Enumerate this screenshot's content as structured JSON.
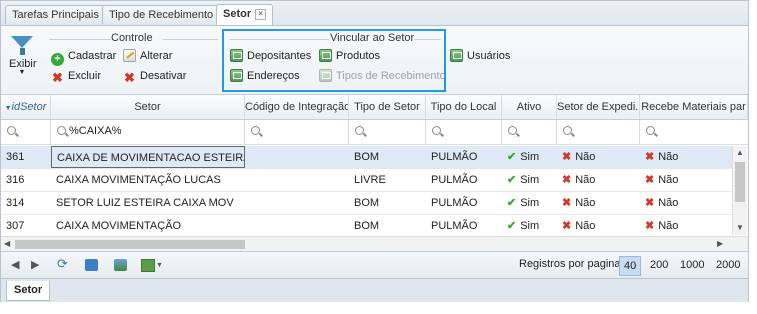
{
  "tabs": [
    {
      "label": "Tarefas Principais",
      "closable": false
    },
    {
      "label": "Tipo de Recebimento",
      "closable": true
    },
    {
      "label": "Setor",
      "closable": true,
      "active": true
    }
  ],
  "ribbon": {
    "exibir_label": "Exibir",
    "controle": {
      "title": "Controle",
      "cadastrar": "Cadastrar",
      "alterar": "Alterar",
      "excluir": "Excluir",
      "desativar": "Desativar"
    },
    "vincular": {
      "title": "Vincular ao Setor",
      "depositantes": "Depositantes",
      "produtos": "Produtos",
      "enderecos": "Endereços",
      "tipos_recebimento": "Tipos de Recebimento",
      "usuarios": "Usuários"
    }
  },
  "grid": {
    "columns": [
      "idSetor",
      "Setor",
      "Código de Integração",
      "Tipo de Setor",
      "Tipo do Local",
      "Ativo",
      "Setor de Expedi...",
      "Recebe Materiais par"
    ],
    "filter_value": "%CAIXA%",
    "rows": [
      {
        "id": "361",
        "setor": "CAIXA DE MOVIMENTACAO ESTEIRA",
        "codigo": "",
        "tipo_setor": "BOM",
        "tipo_local": "PULMÃO",
        "ativo": "Sim",
        "expedicao": "Não",
        "recebe": "Não"
      },
      {
        "id": "316",
        "setor": "CAIXA MOVIMENTAÇÃO LUCAS",
        "codigo": "",
        "tipo_setor": "LIVRE",
        "tipo_local": "PULMÃO",
        "ativo": "Sim",
        "expedicao": "Não",
        "recebe": "Não"
      },
      {
        "id": "314",
        "setor": "SETOR LUIZ ESTEIRA CAIXA MOV",
        "codigo": "",
        "tipo_setor": "BOM",
        "tipo_local": "PULMÃO",
        "ativo": "Sim",
        "expedicao": "Não",
        "recebe": "Não"
      },
      {
        "id": "307",
        "setor": "CAIXA MOVIMENTAÇÃO",
        "codigo": "",
        "tipo_setor": "BOM",
        "tipo_local": "PULMÃO",
        "ativo": "Sim",
        "expedicao": "Não",
        "recebe": "Não"
      }
    ]
  },
  "pager": {
    "label": "Registros por pagina:",
    "sizes": [
      "40",
      "200",
      "1000",
      "2000"
    ],
    "selected": "40"
  },
  "bottom_tab": "Setor"
}
